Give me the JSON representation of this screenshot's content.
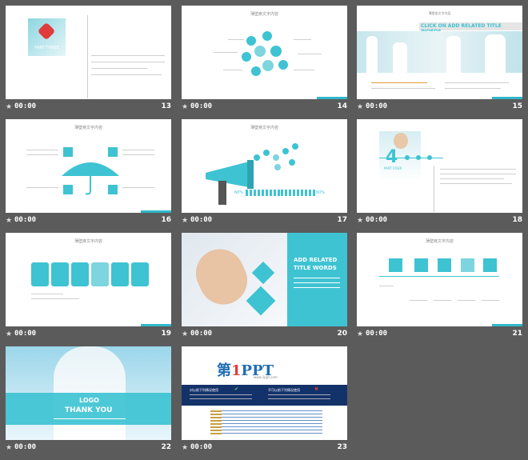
{
  "slides": [
    {
      "num": "13",
      "time": "00:00",
      "caption": "PART THREE"
    },
    {
      "num": "14",
      "time": "00:00",
      "title": "薄壁疾文字内容"
    },
    {
      "num": "15",
      "time": "00:00",
      "title": "CLICK ON ADD RELATED TITLE WORDS"
    },
    {
      "num": "16",
      "time": "00:00",
      "title": "薄壁疾文字内容"
    },
    {
      "num": "17",
      "time": "00:00",
      "title": "薄壁疾文字内容",
      "left_pct": "60%",
      "right_pct": "60%"
    },
    {
      "num": "18",
      "time": "00:00",
      "big_digit": "4",
      "part": "PART FOUR"
    },
    {
      "num": "19",
      "time": "00:00",
      "title": "薄壁疾文字内容"
    },
    {
      "num": "20",
      "time": "00:00",
      "line1": "ADD RELATED",
      "line2": "TITLE WORDS"
    },
    {
      "num": "21",
      "time": "00:00",
      "title": "薄壁疾文字内容"
    },
    {
      "num": "22",
      "time": "00:00",
      "logo": "LOGO",
      "thanks": "THANK  YOU"
    },
    {
      "num": "23",
      "time": "00:00",
      "brand_a": "第",
      "brand_b": "1",
      "brand_c": "PPT",
      "site": "www.1ppt.com",
      "left_head": "对以前下列情况使用",
      "right_head": "不可以前下列情况使用"
    }
  ],
  "icons": {
    "star": "star-icon"
  },
  "colors": {
    "accent": "#3ec3d3",
    "background": "#5b5b5b",
    "selected": "#f4a623"
  }
}
